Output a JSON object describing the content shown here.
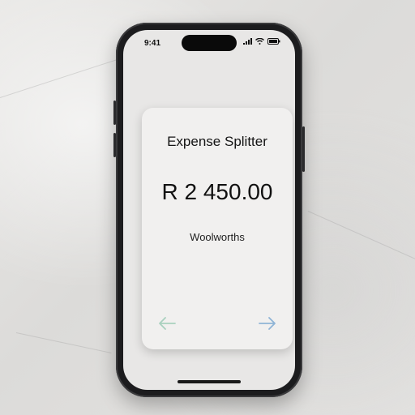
{
  "status_bar": {
    "time": "9:41"
  },
  "card": {
    "title": "Expense Splitter",
    "amount": "R 2 450.00",
    "merchant": "Woolworths"
  },
  "icons": {
    "prev": "arrow-left-icon",
    "next": "arrow-right-icon",
    "signal": "signal-icon",
    "wifi": "wifi-icon",
    "battery": "battery-icon"
  },
  "colors": {
    "prev_arrow": "#a9d1bf",
    "next_arrow": "#8fb4d6"
  }
}
